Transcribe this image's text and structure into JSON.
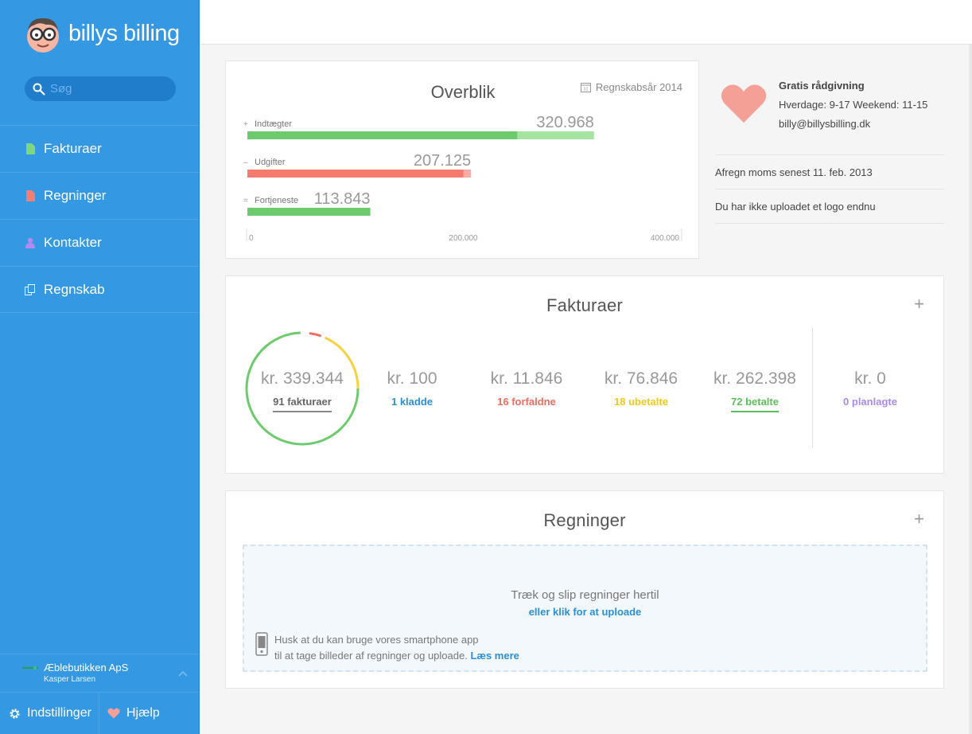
{
  "app": {
    "name": "billys billing"
  },
  "search": {
    "placeholder": "Søg"
  },
  "sidebar": {
    "items": [
      {
        "label": "Fakturaer",
        "icon": "invoice-icon",
        "color": "#7ed67e"
      },
      {
        "label": "Regninger",
        "icon": "bill-icon",
        "color": "#f47d75"
      },
      {
        "label": "Kontakter",
        "icon": "contact-icon",
        "color": "#b58af0"
      },
      {
        "label": "Regnskab",
        "icon": "accounting-icon",
        "color": "#ffffff"
      }
    ],
    "company": "Æblebutikken ApS",
    "user": "Kasper Larsen",
    "settings_label": "Indstillinger",
    "help_label": "Hjælp"
  },
  "overview": {
    "title": "Overblik",
    "fiscal_year": "Regnskabsår 2014",
    "calendar_day": "31"
  },
  "chart_data": {
    "type": "bar",
    "orientation": "horizontal",
    "categories": [
      "Indtægter",
      "Udgifter",
      "Fortjeneste"
    ],
    "prefixes": [
      "+",
      "–",
      "="
    ],
    "values": [
      320968,
      207125,
      113843
    ],
    "value_labels": [
      "320.968",
      "207.125",
      "113.843"
    ],
    "realized_values": [
      250000,
      200000,
      113843
    ],
    "colors": [
      "#6ccb6c",
      "#f67a6d",
      "#6ccb6c"
    ],
    "light_colors": [
      "#a5e3a0",
      "#f8aca3",
      "#a5e3a0"
    ],
    "xlim": [
      0,
      400000
    ],
    "xticks": [
      0,
      200000,
      400000
    ],
    "xtick_labels": [
      "0",
      "200.000",
      "400.000"
    ]
  },
  "info": {
    "heading": "Gratis rådgivning",
    "hours": "Hverdage: 9-17 Weekend: 11-15",
    "email": "billy@billysbilling.dk",
    "vat_notice": "Afregn moms senest 11. feb. 2013",
    "logo_notice": "Du har ikke uploadet et logo endnu"
  },
  "invoices": {
    "title": "Fakturaer",
    "add": "+",
    "total_amount": "kr. 339.344",
    "total_label": "91 fakturaer",
    "donut": {
      "paid_fraction": 0.773,
      "overdue_fraction": 0.035,
      "unpaid_fraction": 0.226,
      "colors": {
        "paid": "#6ccb6c",
        "overdue": "#f26b5e",
        "unpaid": "#f7d23c"
      }
    },
    "stats": [
      {
        "amount": "kr. 100",
        "label": "1 kladde",
        "color": "#2b8fd8"
      },
      {
        "amount": "kr. 11.846",
        "label": "16 forfaldne",
        "color": "#f26b5e"
      },
      {
        "amount": "kr. 76.846",
        "label": "18 ubetalte",
        "color": "#f2c91a"
      },
      {
        "amount": "kr. 262.398",
        "label": "72 betalte",
        "color": "#5cbf5c"
      },
      {
        "amount": "kr. 0",
        "label": "0 planlagte",
        "color": "#a98bf0"
      }
    ]
  },
  "bills": {
    "title": "Regninger",
    "add": "+",
    "drop_text": "Træk og slip regninger hertil",
    "upload_link": "eller klik for at uploade",
    "tip_line1": "Husk at du kan bruge vores smartphone app",
    "tip_line2": "til at tage billeder af regninger og uploade.",
    "tip_link": "Læs mere"
  }
}
